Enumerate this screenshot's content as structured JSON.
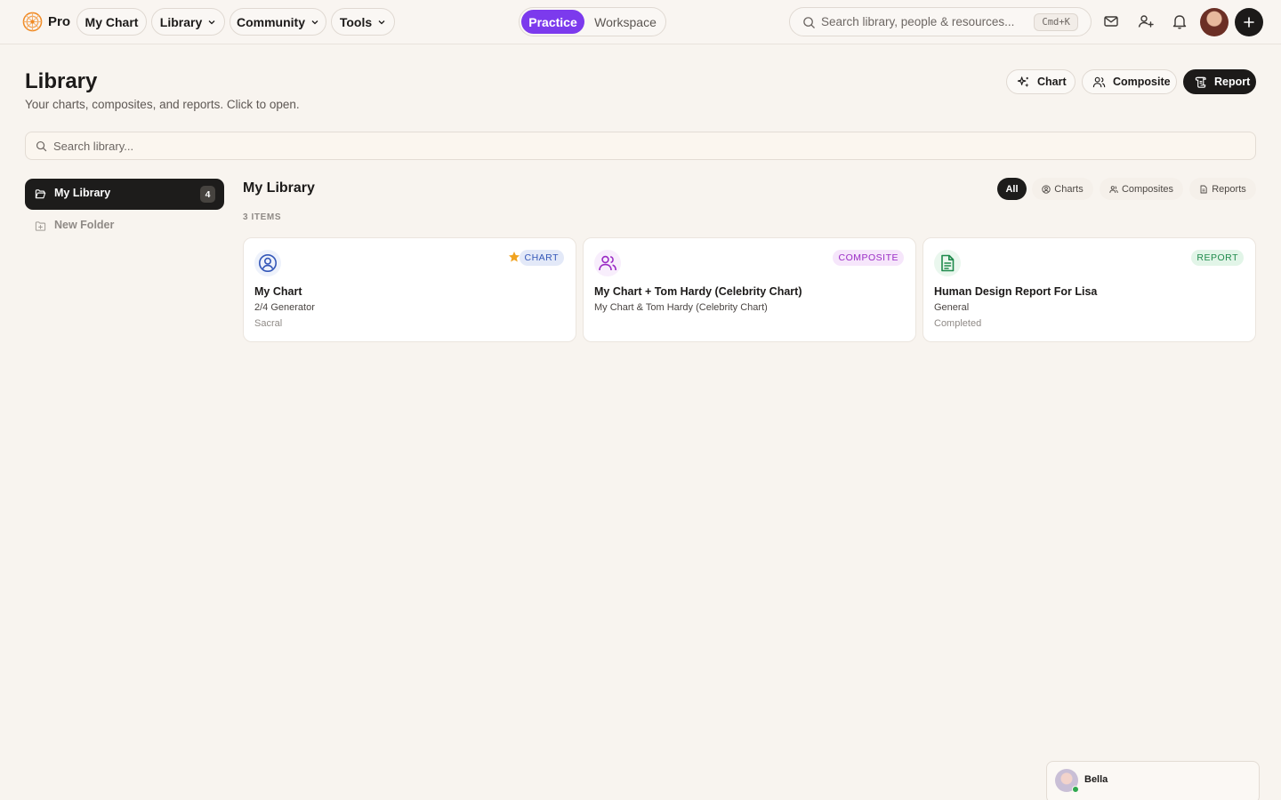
{
  "brand": {
    "name": "Pro",
    "accent": "#7c3aed",
    "logo_color": "#f08a24"
  },
  "topnav": {
    "my_chart": "My Chart",
    "library": "Library",
    "community": "Community",
    "tools": "Tools"
  },
  "mode_switch": {
    "active": "Practice",
    "inactive": "Workspace"
  },
  "search": {
    "placeholder": "Search library, people & resources...",
    "shortcut": "Cmd+K"
  },
  "header": {
    "title": "Library",
    "subtitle": "Your charts, composites, and reports. Click to open.",
    "actions": {
      "chart": "Chart",
      "composite": "Composite",
      "report": "Report"
    }
  },
  "library_search": {
    "placeholder": "Search library..."
  },
  "sidebar": {
    "active": {
      "label": "My Library",
      "count": "4"
    },
    "items": [
      {
        "label": "New Folder"
      }
    ]
  },
  "main": {
    "title": "My Library",
    "item_count": "3 ITEMS",
    "filters": {
      "all": "All",
      "charts": "Charts",
      "composites": "Composites",
      "reports": "Reports"
    },
    "cards": [
      {
        "type": "CHART",
        "starred": true,
        "icon": "user-circle-icon",
        "title": "My Chart",
        "line1": "2/4 Generator",
        "line2": "Sacral",
        "badge_color": "#3457b8",
        "badge_bg": "#e3e9f8"
      },
      {
        "type": "COMPOSITE",
        "starred": false,
        "icon": "users-icon",
        "title": "My Chart + Tom Hardy (Celebrity Chart)",
        "line1": "My Chart & Tom Hardy (Celebrity Chart)",
        "line2": "",
        "badge_color": "#9a2bc4",
        "badge_bg": "#f6e6fb"
      },
      {
        "type": "REPORT",
        "starred": false,
        "icon": "document-icon",
        "title": "Human Design Report For Lisa",
        "line1": "General",
        "line2": "Completed",
        "badge_color": "#1f8a4c",
        "badge_bg": "#e2f5e8"
      }
    ]
  },
  "assistant": {
    "name": "Bella",
    "status": "online"
  }
}
